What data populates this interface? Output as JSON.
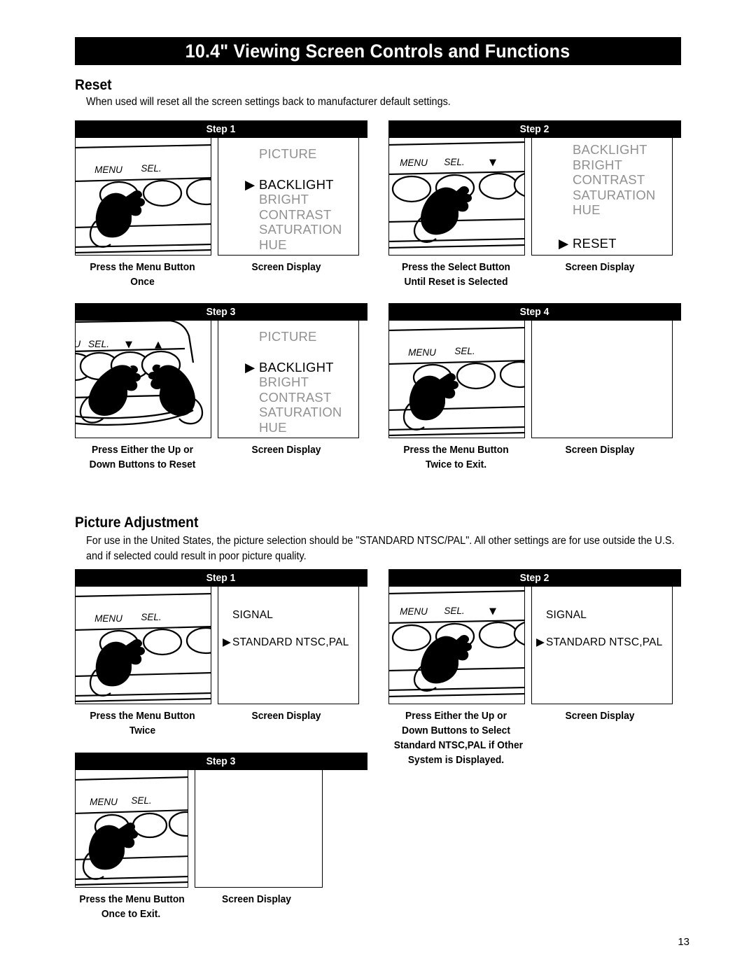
{
  "header": {
    "title": "10.4\" Viewing Screen Controls and Functions"
  },
  "page_number": "13",
  "sections": [
    {
      "heading": "Reset",
      "body": "When used will reset all the screen settings back to manufacturer default settings."
    },
    {
      "heading": "Picture Adjustment",
      "body": "For use in the United States, the picture selection should be \"STANDARD NTSC/PAL\". All other settings are for use outside the U.S. and if selected could result in poor picture quality."
    }
  ],
  "labels": {
    "screen_display": "Screen Display",
    "menu": "MENU",
    "sel": "SEL.",
    "menu_cropped": "U",
    "down_arrow": "▼",
    "up_arrow": "▲",
    "marker": "▶"
  },
  "reset_steps": [
    {
      "title": "Step 1",
      "caption": "Press the Menu Button\nOnce",
      "screen_caption": "Screen Display",
      "osd": {
        "kind": "menu",
        "header": {
          "text": "PICTURE",
          "state": "gray"
        },
        "items": [
          {
            "text": "BACKLIGHT",
            "state": "black",
            "selected": true
          },
          {
            "text": "BRIGHT",
            "state": "gray",
            "selected": false
          },
          {
            "text": "CONTRAST",
            "state": "gray",
            "selected": false
          },
          {
            "text": "SATURATION",
            "state": "gray",
            "selected": false
          },
          {
            "text": "HUE",
            "state": "gray",
            "selected": false
          }
        ],
        "footer": null
      }
    },
    {
      "title": "Step 2",
      "caption": "Press the Select Button\nUntil Reset is Selected",
      "screen_caption": "Screen Display",
      "osd": {
        "kind": "menu",
        "header": null,
        "items": [
          {
            "text": "BACKLIGHT",
            "state": "gray",
            "selected": false
          },
          {
            "text": "BRIGHT",
            "state": "gray",
            "selected": false
          },
          {
            "text": "CONTRAST",
            "state": "gray",
            "selected": false
          },
          {
            "text": "SATURATION",
            "state": "gray",
            "selected": false
          },
          {
            "text": "HUE",
            "state": "gray",
            "selected": false
          }
        ],
        "footer": {
          "text": "RESET",
          "state": "black",
          "selected": true
        }
      }
    },
    {
      "title": "Step 3",
      "caption": "Press Either the Up or\nDown Buttons to Reset",
      "screen_caption": "Screen Display",
      "osd": {
        "kind": "menu",
        "header": {
          "text": "PICTURE",
          "state": "gray"
        },
        "items": [
          {
            "text": "BACKLIGHT",
            "state": "black",
            "selected": true
          },
          {
            "text": "BRIGHT",
            "state": "gray",
            "selected": false
          },
          {
            "text": "CONTRAST",
            "state": "gray",
            "selected": false
          },
          {
            "text": "SATURATION",
            "state": "gray",
            "selected": false
          },
          {
            "text": "HUE",
            "state": "gray",
            "selected": false
          }
        ],
        "footer": null
      }
    },
    {
      "title": "Step 4",
      "caption": "Press the Menu Button\nTwice to Exit.",
      "screen_caption": "Screen Display",
      "osd": {
        "kind": "blank"
      }
    }
  ],
  "picture_steps": [
    {
      "title": "Step 1",
      "caption": "Press the Menu Button\nTwice",
      "screen_caption": "Screen Display",
      "osd": {
        "kind": "signal",
        "header": {
          "text": "SIGNAL",
          "state": "black"
        },
        "items": [
          {
            "text": "STANDARD  NTSC,PAL",
            "state": "black",
            "selected": true
          }
        ]
      }
    },
    {
      "title": "Step 2",
      "caption": "Press Either the Up or\nDown Buttons to Select\nStandard NTSC,PAL if Other\nSystem is Displayed.",
      "screen_caption": "Screen Display",
      "osd": {
        "kind": "signal",
        "header": {
          "text": "SIGNAL",
          "state": "black"
        },
        "items": [
          {
            "text": "STANDARD  NTSC,PAL",
            "state": "black",
            "selected": true
          }
        ]
      }
    },
    {
      "title": "Step 3",
      "caption": "Press the Menu Button\nOnce to Exit.",
      "screen_caption": "Screen Display",
      "osd": {
        "kind": "blank"
      }
    }
  ]
}
